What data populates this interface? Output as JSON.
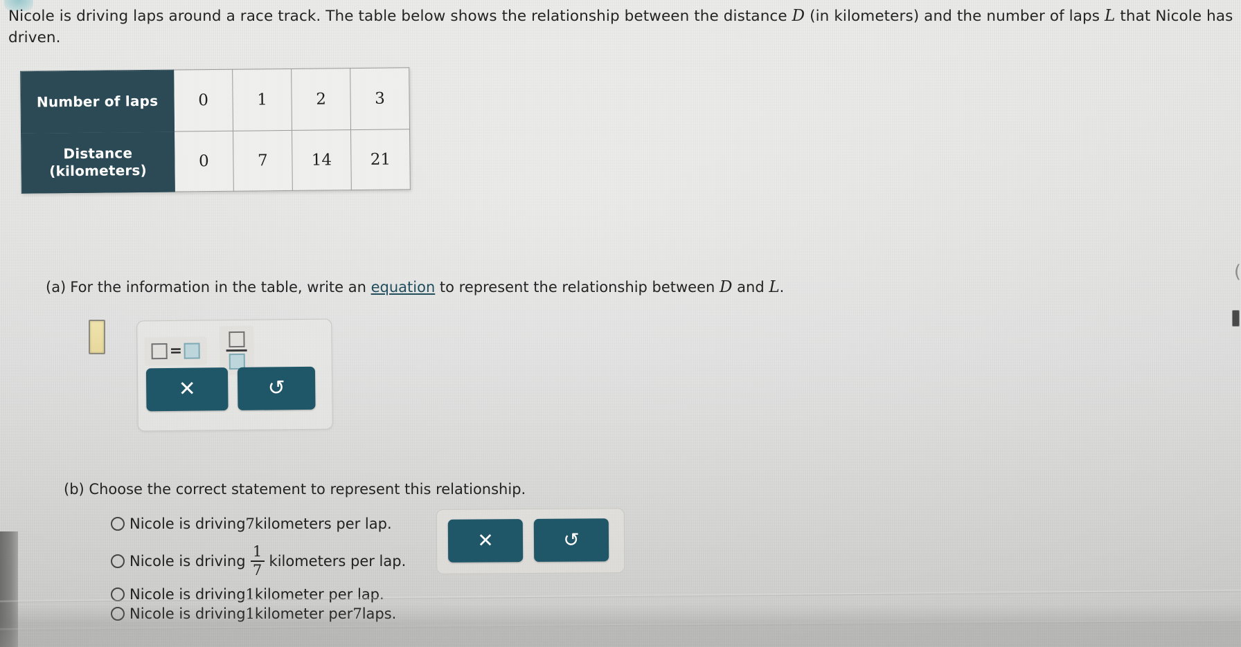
{
  "prompt": {
    "line1_a": "Nicole is driving laps around a race track. The table below shows the relationship between the distance ",
    "var_D": "D",
    "line1_b": " (in kilometers) and the number of laps ",
    "var_L": "L",
    "line1_c": " that Nicole",
    "line2": "has driven."
  },
  "table": {
    "row_headers": [
      "Number of laps",
      "Distance\n(kilometers)"
    ],
    "row1_label": "Number of laps",
    "row2_label_line1": "Distance",
    "row2_label_line2": "(kilometers)",
    "laps": [
      "0",
      "1",
      "2",
      "3"
    ],
    "distance": [
      "0",
      "7",
      "14",
      "21"
    ]
  },
  "part_a": {
    "label": "(a)",
    "text_before_link": "For the information in the table, write an ",
    "link_text": "equation",
    "text_after_link": " to represent the relationship between ",
    "var_D": "D",
    "and_text": " and ",
    "var_L": "L",
    "period": ".",
    "answer_value": "",
    "answer_placeholder": "",
    "toolbar": {
      "equation_tool_label": "□=□",
      "equation_tool_name": "equation-template",
      "fraction_tool_label": "□/□",
      "fraction_tool_name": "fraction-template",
      "clear_label": "✕",
      "clear_name": "clear-button",
      "undo_label": "↺",
      "undo_name": "undo-button"
    }
  },
  "part_b": {
    "label": "(b)",
    "text": "Choose the correct statement to represent this relationship.",
    "choices": [
      {
        "id": "choice-1",
        "prefix": "Nicole is driving ",
        "value": "7",
        "suffix": " kilometers per lap.",
        "is_fraction": false,
        "selected": false
      },
      {
        "id": "choice-2",
        "prefix": "Nicole is driving ",
        "numerator": "1",
        "denominator": "7",
        "suffix": "kilometers per lap.",
        "is_fraction": true,
        "selected": false
      },
      {
        "id": "choice-3",
        "prefix": "Nicole is driving ",
        "value": "1",
        "suffix": " kilometer per lap.",
        "is_fraction": false,
        "selected": false
      },
      {
        "id": "choice-4",
        "prefix": "Nicole is driving ",
        "value": "1",
        "mid": " kilometer per ",
        "value2": "7",
        "suffix": " laps.",
        "is_fraction": false,
        "selected": false
      }
    ],
    "toolbar": {
      "clear_label": "✕",
      "undo_label": "↺"
    }
  },
  "colors": {
    "table_header_bg": "#2c4a55",
    "button_teal": "#1f5668",
    "link_color": "#1f4d5c",
    "answer_box_fill": "#efe3ad",
    "page_bg": "#e4e4e2",
    "fraction_tile": "#bcd6dc"
  }
}
